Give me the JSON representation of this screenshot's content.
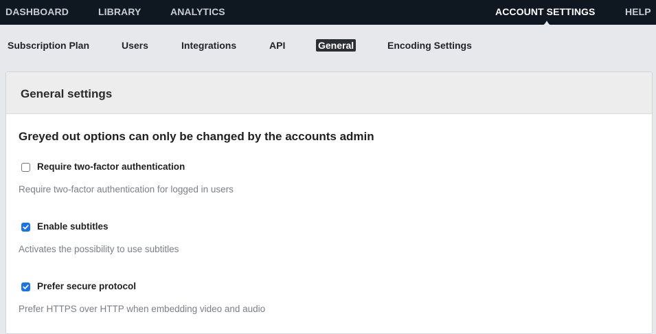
{
  "top_nav": {
    "items": [
      {
        "label": "DASHBOARD"
      },
      {
        "label": "LIBRARY"
      },
      {
        "label": "ANALYTICS"
      },
      {
        "label": "ACCOUNT SETTINGS",
        "active": true
      },
      {
        "label": "HELP"
      }
    ]
  },
  "sub_nav": {
    "tabs": [
      {
        "label": "Subscription Plan"
      },
      {
        "label": "Users"
      },
      {
        "label": "Integrations"
      },
      {
        "label": "API"
      },
      {
        "label": "General",
        "active": true
      },
      {
        "label": "Encoding Settings"
      }
    ]
  },
  "panel": {
    "title": "General settings",
    "notice": "Greyed out options can only be changed by the accounts admin",
    "options": [
      {
        "label": "Require two-factor authentication",
        "description": "Require two-factor authentication for logged in users",
        "checked": false
      },
      {
        "label": "Enable subtitles",
        "description": "Activates the possibility to use subtitles",
        "checked": true
      },
      {
        "label": "Prefer secure protocol",
        "description": "Prefer HTTPS over HTTP when embedding video and audio",
        "checked": true
      }
    ]
  },
  "colors": {
    "top_nav_bg": "#0f1820",
    "page_bg": "#e6e8eb",
    "checkbox_accent": "#1a73e8"
  }
}
